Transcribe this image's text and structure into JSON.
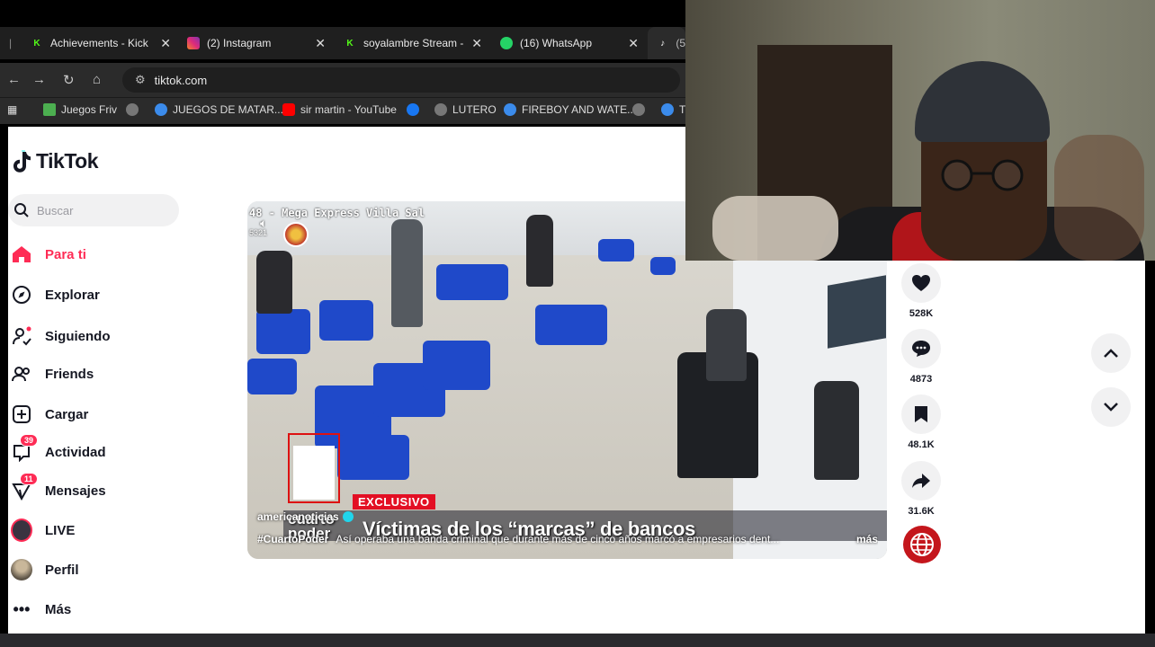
{
  "browser": {
    "tabs": [
      {
        "label": "Achievements - Kick",
        "icon": "kick-icon",
        "color": "#53fc18"
      },
      {
        "label": "(2) Instagram",
        "icon": "instagram-icon",
        "color": "#e1306c"
      },
      {
        "label": "soyalambre Stream -",
        "icon": "kick-icon",
        "color": "#53fc18"
      },
      {
        "label": "(16) WhatsApp",
        "icon": "whatsapp-icon",
        "color": "#25d366"
      },
      {
        "label": "(5",
        "icon": "tiktok-icon",
        "color": "#ffffff"
      }
    ],
    "url": "tiktok.com",
    "bookmarks": [
      {
        "label": "Juegos Friv"
      },
      {
        "label": ""
      },
      {
        "label": "JUEGOS DE MATAR..."
      },
      {
        "label": "sir martin - YouTube"
      },
      {
        "label": ""
      },
      {
        "label": "LUTERO"
      },
      {
        "label": "FIREBOY AND WATE..."
      },
      {
        "label": ""
      },
      {
        "label": "Ti"
      }
    ]
  },
  "sidebar": {
    "logo": "TikTok",
    "search_placeholder": "Buscar",
    "items": [
      {
        "label": "Para ti",
        "icon": "home-icon",
        "active": true
      },
      {
        "label": "Explorar",
        "icon": "compass-icon"
      },
      {
        "label": "Siguiendo",
        "icon": "following-icon"
      },
      {
        "label": "Friends",
        "icon": "friends-icon"
      },
      {
        "label": "Cargar",
        "icon": "upload-icon"
      },
      {
        "label": "Actividad",
        "icon": "activity-icon",
        "badge": "39"
      },
      {
        "label": "Mensajes",
        "icon": "messages-icon",
        "badge": "11"
      },
      {
        "label": "LIVE",
        "icon": "live-icon"
      },
      {
        "label": "Perfil",
        "icon": "profile-icon"
      },
      {
        "label": "Más",
        "icon": "more-icon"
      }
    ]
  },
  "video": {
    "osd_text": "48 - Mega Express Villa   Sal",
    "osd_sub": "5321",
    "tag": "EXCLUSIVO",
    "brand": "cuarto poder",
    "headline": "Víctimas de los “marcas” de bancos",
    "author": "americanoticias",
    "hashtag": "#CuartoPoder",
    "description": "Así operaba una banda criminal que durante más de cinco años marcó a empresarios dent...",
    "more_label": "más"
  },
  "actions": {
    "likes": "528K",
    "comments": "4873",
    "saves": "48.1K",
    "shares": "31.6K"
  },
  "colors": {
    "accent": "#fe2c55",
    "text": "#161823"
  }
}
